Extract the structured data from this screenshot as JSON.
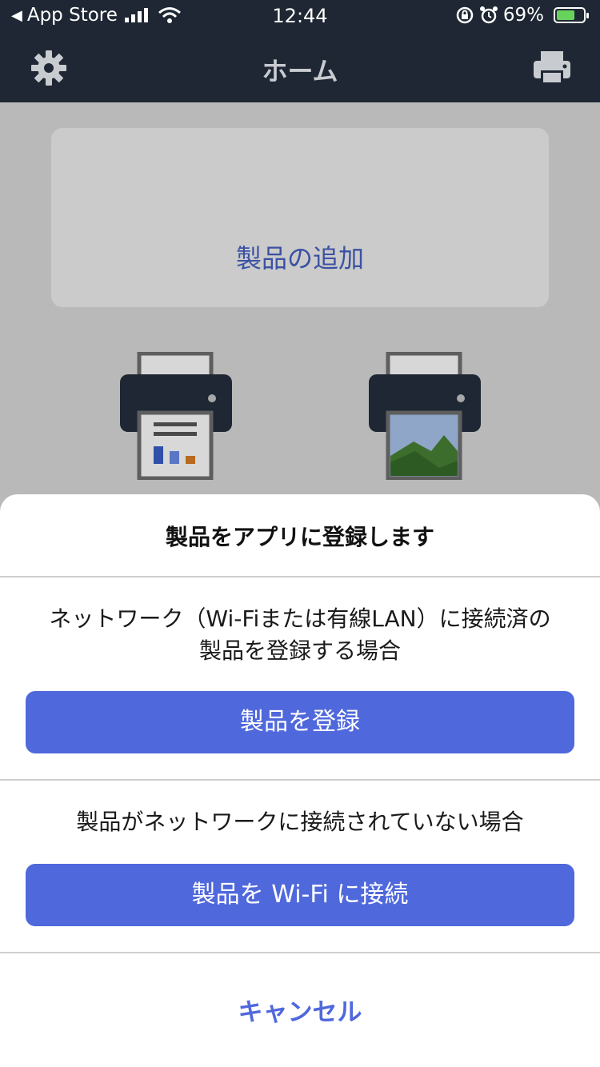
{
  "status_bar": {
    "back_app": "App Store",
    "time": "12:44",
    "battery": "69%"
  },
  "nav": {
    "title": "ホーム",
    "left_icon": "gear-icon",
    "right_icon": "printer-icon"
  },
  "add_card": {
    "label": "製品の追加",
    "icon": "add-printer-icon"
  },
  "colors": {
    "nav_bg": "#1e2733",
    "accent": "#4f68dc",
    "card_icon": "#3c51a4"
  },
  "sheet": {
    "title": "製品をアプリに登録します",
    "section1_desc_line1": "ネットワーク（Wi-Fiまたは有線LAN）に接続済の",
    "section1_desc_line2": "製品を登録する場合",
    "register_button": "製品を登録",
    "section2_desc": "製品がネットワークに接続されていない場合",
    "wifi_button": "製品を Wi-Fi に接続",
    "cancel": "キャンセル"
  }
}
